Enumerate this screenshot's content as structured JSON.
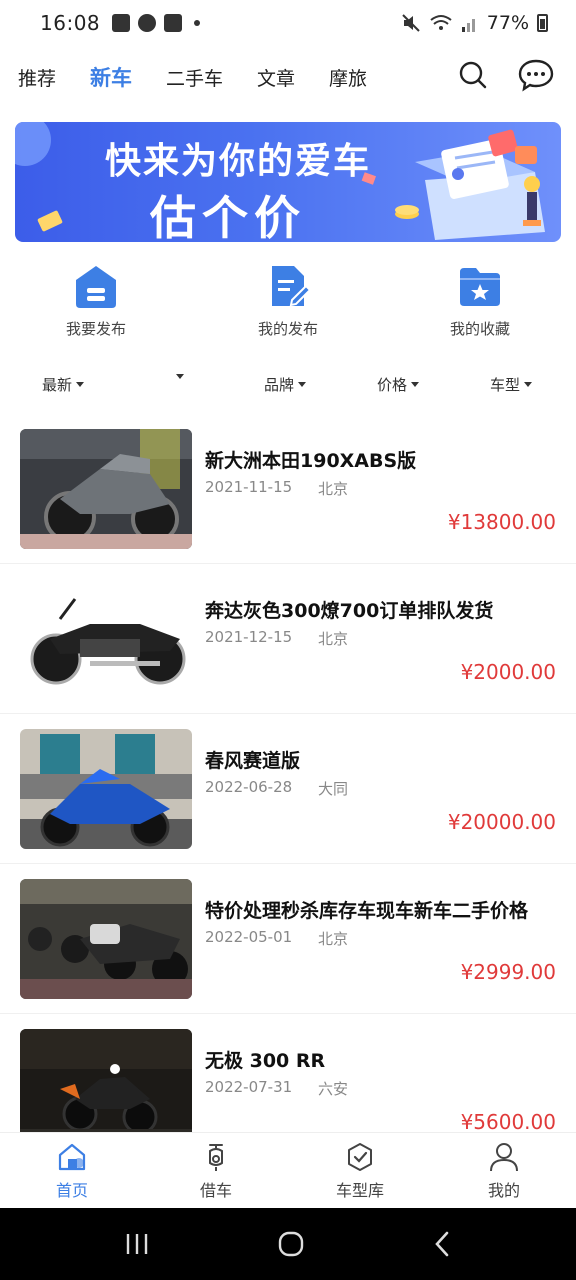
{
  "status_bar": {
    "time": "16:08",
    "battery": "77%"
  },
  "top_tabs": [
    {
      "label": "推荐",
      "active": false
    },
    {
      "label": "新车",
      "active": true
    },
    {
      "label": "二手车",
      "active": false
    },
    {
      "label": "文章",
      "active": false
    },
    {
      "label": "摩旅",
      "active": false
    }
  ],
  "banner": {
    "line1": "快来为你的爱车",
    "line2": "估个价"
  },
  "quick_actions": [
    {
      "label": "我要发布",
      "icon": "house-icon"
    },
    {
      "label": "我的发布",
      "icon": "document-edit-icon"
    },
    {
      "label": "我的收藏",
      "icon": "folder-star-icon"
    }
  ],
  "filters": [
    {
      "label": "最新"
    },
    {
      "label": ""
    },
    {
      "label": "品牌"
    },
    {
      "label": "价格"
    },
    {
      "label": "车型"
    }
  ],
  "listings": [
    {
      "title": "新大洲本田190XABS版",
      "date": "2021-11-15",
      "city": "北京",
      "price": "¥13800.00"
    },
    {
      "title": "奔达灰色300燎700订单排队发货",
      "date": "2021-12-15",
      "city": "北京",
      "price": "¥2000.00"
    },
    {
      "title": "春风赛道版",
      "date": "2022-06-28",
      "city": "大同",
      "price": "¥20000.00"
    },
    {
      "title": "特价处理秒杀库存车现车新车二手价格",
      "date": "2022-05-01",
      "city": "北京",
      "price": "¥2999.00"
    },
    {
      "title": "无极 300 RR",
      "date": "2022-07-31",
      "city": "六安",
      "price": "¥5600.00"
    }
  ],
  "bottom_tabs": [
    {
      "label": "首页",
      "icon": "home-icon",
      "active": true
    },
    {
      "label": "借车",
      "icon": "scooter-icon",
      "active": false
    },
    {
      "label": "车型库",
      "icon": "box-check-icon",
      "active": false
    },
    {
      "label": "我的",
      "icon": "user-icon",
      "active": false
    }
  ],
  "colors": {
    "accent": "#3d7fe4",
    "price": "#e03a3a",
    "banner": "#4b6ef0"
  }
}
